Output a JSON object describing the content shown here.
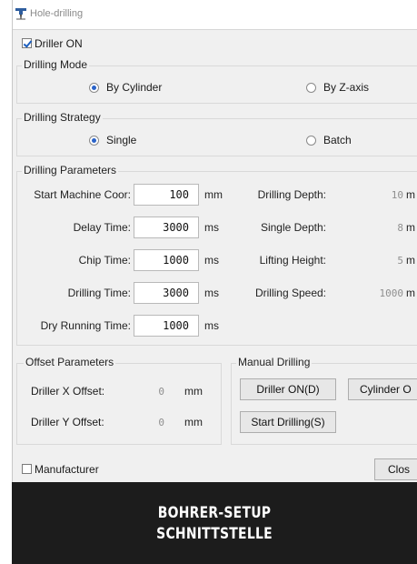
{
  "window": {
    "title": "Hole-drilling"
  },
  "driller_on": {
    "label": "Driller ON",
    "checked": true
  },
  "drilling_mode": {
    "title": "Drilling Mode",
    "options": [
      {
        "label": "By Cylinder",
        "selected": true
      },
      {
        "label": "By Z-axis",
        "selected": false
      }
    ]
  },
  "drilling_strategy": {
    "title": "Drilling Strategy",
    "options": [
      {
        "label": "Single",
        "selected": true
      },
      {
        "label": "Batch",
        "selected": false
      }
    ]
  },
  "drilling_parameters": {
    "title": "Drilling Parameters",
    "left": [
      {
        "label": "Start Machine Coor:",
        "value": "100",
        "unit": "mm"
      },
      {
        "label": "Delay Time:",
        "value": "3000",
        "unit": "ms"
      },
      {
        "label": "Chip Time:",
        "value": "1000",
        "unit": "ms"
      },
      {
        "label": "Drilling Time:",
        "value": "3000",
        "unit": "ms"
      },
      {
        "label": "Dry Running Time:",
        "value": "1000",
        "unit": "ms"
      }
    ],
    "right": [
      {
        "label": "Drilling Depth:",
        "value": "10",
        "unit": "m"
      },
      {
        "label": "Single Depth:",
        "value": "8",
        "unit": "m"
      },
      {
        "label": "Lifting Height:",
        "value": "5",
        "unit": "m"
      },
      {
        "label": "Drilling Speed:",
        "value": "1000",
        "unit": "m"
      }
    ]
  },
  "offset_parameters": {
    "title": "Offset Parameters",
    "rows": [
      {
        "label": "Driller X Offset:",
        "value": "0",
        "unit": "mm"
      },
      {
        "label": "Driller Y Offset:",
        "value": "0",
        "unit": "mm"
      }
    ]
  },
  "manual_drilling": {
    "title": "Manual Drilling",
    "buttons": {
      "driller_on": "Driller ON(D)",
      "cylinder": "Cylinder O",
      "start_drilling": "Start Drilling(S)"
    }
  },
  "manufacturer": {
    "label": "Manufacturer",
    "checked": false
  },
  "close_button": "Clos",
  "banner": {
    "line1": "BOHRER-SETUP",
    "line2": "SCHNITTSTELLE"
  },
  "colors": {
    "window_bg": "#f0f0f0",
    "radio_dot": "#2a63c9",
    "banner_bg": "#1c1c1c"
  }
}
